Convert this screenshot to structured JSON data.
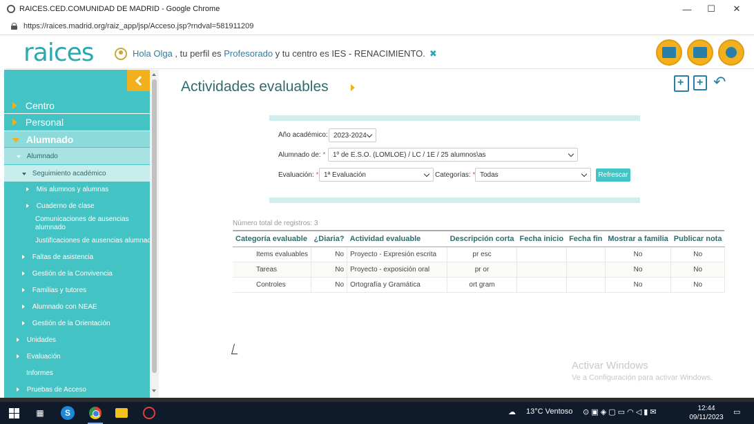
{
  "browser": {
    "window_title": "RAICES.CED.COMUNIDAD DE MADRID - Google Chrome",
    "url": "https://raices.madrid.org/raiz_app/jsp/Acceso.jsp?rndval=581911209",
    "minimize": "—",
    "maximize": "☐",
    "close": "✕"
  },
  "header": {
    "logo": "raices",
    "greeting_prefix": "Hola Olga",
    "greeting_mid1": " , tu perfil es ",
    "profile": "Profesorado",
    "greeting_mid2": " y tu centro es IES - RENACIMIENTO.",
    "close_mark": "✖"
  },
  "sidebar": {
    "centro": "Centro",
    "personal": "Personal",
    "alumnado_top": "Alumnado",
    "alumnado_sub": "Alumnado",
    "seguimiento": "Seguimiento académico",
    "mis_alumnos": "Mis alumnos y alumnas",
    "cuaderno": "Cuaderno de clase",
    "comunicaciones_l1": "Comunicaciones de ausencias",
    "comunicaciones_l2": "alumnado",
    "justificaciones": "Justificaciones de ausencias alumnado",
    "faltas": "Faltas de asistencia",
    "convivencia": "Gestión de la Convivencia",
    "familias": "Familias y tutores",
    "neae": "Alumnado con NEAE",
    "orientacion": "Gestión de la Orientación",
    "unidades": "Unidades",
    "evaluacion": "Evaluación",
    "informes": "Informes",
    "pruebas": "Pruebas de Acceso"
  },
  "main": {
    "title": "Actividades evaluables",
    "filters": {
      "anio_label": "Año académico:",
      "anio_value": "2023-2024",
      "alumnado_label": "Alumnado de:",
      "alumnado_value": "1º de E.S.O. (LOMLOE) / LC / 1E / 25 alumnos\\as",
      "evaluacion_label": "Evaluación:",
      "evaluacion_value": "1ª Evaluación",
      "categorias_label": "Categorías:",
      "categorias_value": "Todas",
      "required_mark": "*",
      "refresh_label": "Refrescar"
    },
    "count_text": "Número total de registros: 3",
    "table": {
      "headers": [
        "Categoría evaluable",
        "¿Diaria?",
        "Actividad evaluable",
        "Descripción corta",
        "Fecha inicio",
        "Fecha fin",
        "Mostrar a familia",
        "Publicar nota"
      ],
      "rows": [
        [
          "Items evaluables",
          "No",
          "Proyecto - Expresión escrita",
          "pr esc",
          "",
          "",
          "No",
          "No"
        ],
        [
          "Tareas",
          "No",
          "Proyecto - exposición oral",
          "pr or",
          "",
          "",
          "No",
          "No"
        ],
        [
          "Controles",
          "No",
          "Ortografía y Gramática",
          "ort gram",
          "",
          "",
          "No",
          "No"
        ]
      ]
    }
  },
  "watermark": {
    "line1": "Activar Windows",
    "line2": "Ve a Configuración para activar Windows."
  },
  "taskbar": {
    "weather": "13°C  Ventoso",
    "time": "12:44",
    "date": "09/11/2023",
    "skype_letter": "S"
  },
  "colors": {
    "sidebar": "#43c3c3",
    "accent": "#f2b01e",
    "title": "#2d6c6f"
  }
}
